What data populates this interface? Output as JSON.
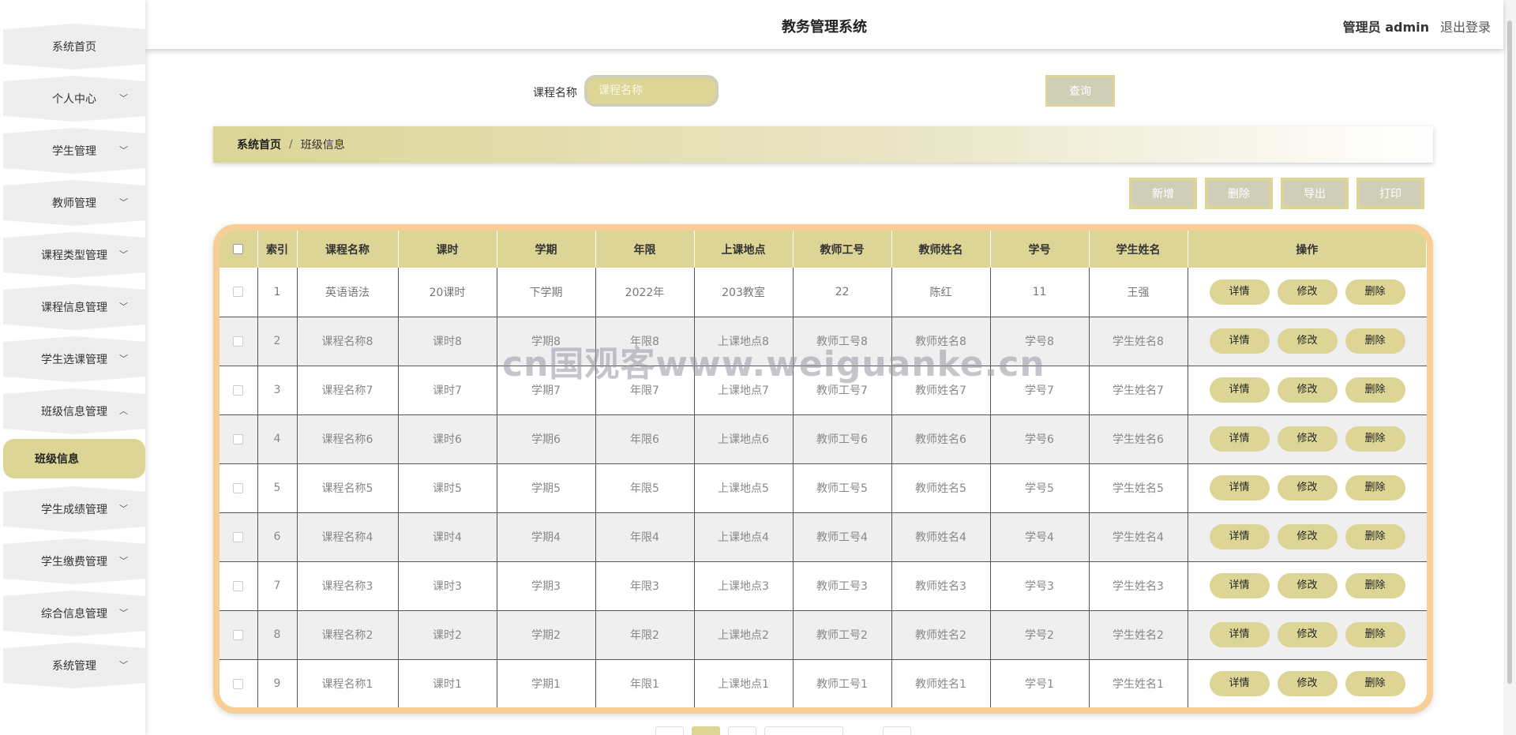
{
  "app": {
    "title": "教务管理系统",
    "user": "管理员 admin",
    "logout": "退出登录"
  },
  "sidebar": {
    "items": [
      {
        "label": "系统首页",
        "has_children": false
      },
      {
        "label": "个人中心",
        "has_children": true,
        "expanded": false
      },
      {
        "label": "学生管理",
        "has_children": true,
        "expanded": false
      },
      {
        "label": "教师管理",
        "has_children": true,
        "expanded": false
      },
      {
        "label": "课程类型管理",
        "has_children": true,
        "expanded": false
      },
      {
        "label": "课程信息管理",
        "has_children": true,
        "expanded": false
      },
      {
        "label": "学生选课管理",
        "has_children": true,
        "expanded": false
      },
      {
        "label": "班级信息管理",
        "has_children": true,
        "expanded": true,
        "children": [
          "班级信息"
        ]
      },
      {
        "label": "学生成绩管理",
        "has_children": true,
        "expanded": false
      },
      {
        "label": "学生缴费管理",
        "has_children": true,
        "expanded": false
      },
      {
        "label": "综合信息管理",
        "has_children": true,
        "expanded": false
      },
      {
        "label": "系统管理",
        "has_children": true,
        "expanded": false
      }
    ]
  },
  "search": {
    "label": "课程名称",
    "placeholder": "课程名称",
    "value": "",
    "button": "查询"
  },
  "breadcrumb": {
    "home": "系统首页",
    "separator": "/",
    "current": "班级信息"
  },
  "actions": {
    "add": "新增",
    "delete": "删除",
    "export": "导出",
    "print": "打印"
  },
  "table": {
    "columns": [
      "索引",
      "课程名称",
      "课时",
      "学期",
      "年限",
      "上课地点",
      "教师工号",
      "教师姓名",
      "学号",
      "学生姓名",
      "操作"
    ],
    "row_actions": {
      "detail": "详情",
      "edit": "修改",
      "delete": "删除"
    },
    "rows": [
      [
        "1",
        "英语语法",
        "20课时",
        "下学期",
        "2022年",
        "203教室",
        "22",
        "陈红",
        "11",
        "王强"
      ],
      [
        "2",
        "课程名称8",
        "课时8",
        "学期8",
        "年限8",
        "上课地点8",
        "教师工号8",
        "教师姓名8",
        "学号8",
        "学生姓名8"
      ],
      [
        "3",
        "课程名称7",
        "课时7",
        "学期7",
        "年限7",
        "上课地点7",
        "教师工号7",
        "教师姓名7",
        "学号7",
        "学生姓名7"
      ],
      [
        "4",
        "课程名称6",
        "课时6",
        "学期6",
        "年限6",
        "上课地点6",
        "教师工号6",
        "教师姓名6",
        "学号6",
        "学生姓名6"
      ],
      [
        "5",
        "课程名称5",
        "课时5",
        "学期5",
        "年限5",
        "上课地点5",
        "教师工号5",
        "教师姓名5",
        "学号5",
        "学生姓名5"
      ],
      [
        "6",
        "课程名称4",
        "课时4",
        "学期4",
        "年限4",
        "上课地点4",
        "教师工号4",
        "教师姓名4",
        "学号4",
        "学生姓名4"
      ],
      [
        "7",
        "课程名称3",
        "课时3",
        "学期3",
        "年限3",
        "上课地点3",
        "教师工号3",
        "教师姓名3",
        "学号3",
        "学生姓名3"
      ],
      [
        "8",
        "课程名称2",
        "课时2",
        "学期2",
        "年限2",
        "上课地点2",
        "教师工号2",
        "教师姓名2",
        "学号2",
        "学生姓名2"
      ],
      [
        "9",
        "课程名称1",
        "课时1",
        "学期1",
        "年限1",
        "上课地点1",
        "教师工号1",
        "教师姓名1",
        "学号1",
        "学生姓名1"
      ]
    ]
  },
  "watermark": "cn国观客www.weiguanke.cn",
  "colors": {
    "accent": "#dcd596",
    "button_bg": "#cfcfb8",
    "table_border": "#f8cd96",
    "menu_bg": "#eeeeee"
  }
}
